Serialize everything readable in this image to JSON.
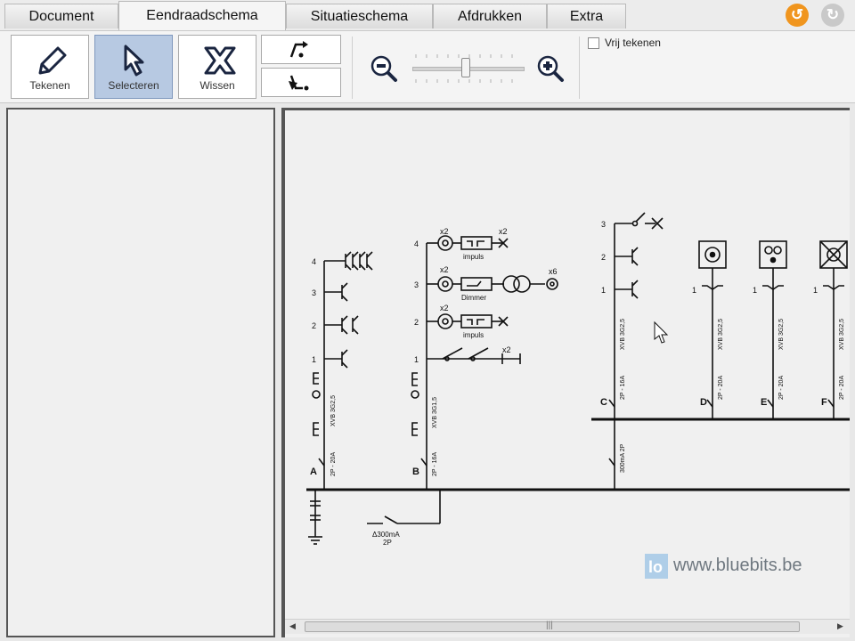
{
  "tabs": [
    {
      "label": "Document"
    },
    {
      "label": "Eendraadschema"
    },
    {
      "label": "Situatieschema"
    },
    {
      "label": "Afdrukken"
    },
    {
      "label": "Extra"
    }
  ],
  "toolbar": {
    "tekenen": "Tekenen",
    "selecteren": "Selecteren",
    "wissen": "Wissen",
    "vrij_tekenen": "Vrij tekenen",
    "zoom_level": 0.5
  },
  "schema": {
    "circuits": [
      "A",
      "B",
      "C",
      "D",
      "E",
      "F"
    ],
    "numbers": [
      "1",
      "2",
      "3",
      "4"
    ],
    "cable_a": "XVB 3G2,5",
    "cable_b": "XVB 3G1,5",
    "cable_c": "XVB 3G2,5",
    "rating_20": "2P - 20A",
    "rating_16": "2P - 16A",
    "rcd_rating": "300mA 2P",
    "rcd_main": "Δ300mA",
    "rcd_main_2": "2P",
    "x2": "x2",
    "x6": "x6",
    "impuls": "impuls",
    "dimmer": "Dimmer"
  },
  "watermark": "www.bluebits.be",
  "colors": {
    "accent_orange": "#f0951e",
    "selected_tool": "#b7c9e2",
    "wire": "#111111"
  }
}
